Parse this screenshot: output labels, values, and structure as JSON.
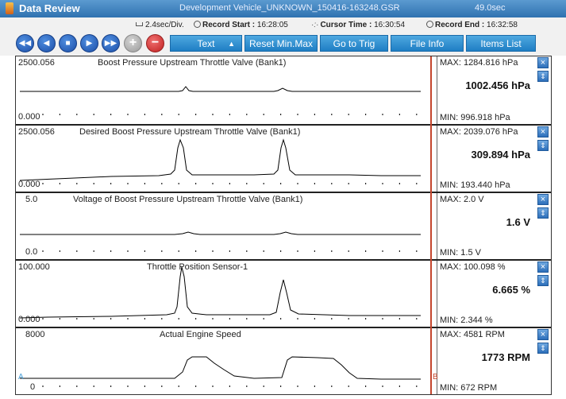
{
  "window": {
    "title": "Data Review",
    "file_name": "Development Vehicle_UNKNOWN_150416-163248.GSR",
    "duration": "49.0sec"
  },
  "info": {
    "time_div": "2.4sec/Div.",
    "record_start_label": "Record Start :",
    "record_start_value": "16:28:05",
    "cursor_time_label": "Cursor Time :",
    "cursor_time_value": "16:30:54",
    "record_end_label": "Record End :",
    "record_end_value": "16:32:58"
  },
  "toolbar": {
    "first_icon": "skip-back-icon",
    "prev_icon": "play-reverse-icon",
    "stop_icon": "stop-icon",
    "play_icon": "play-icon",
    "next_icon": "skip-forward-icon",
    "zoom_in_symbol": "+",
    "zoom_out_symbol": "−",
    "text_select_label": "Text",
    "reset_label": "Reset Min.Max",
    "goto_trig_label": "Go to Trig",
    "file_info_label": "File Info",
    "items_list_label": "Items List"
  },
  "cursor": {
    "label_a": "A",
    "label_b": "B"
  },
  "channels": [
    {
      "name": "Boost Pressure Upstream Throttle Valve (Bank1)",
      "scale_max": "2500.056",
      "scale_min": "0.000",
      "max_text": "MAX: 1284.816 hPa",
      "min_text": "MIN: 996.918 hPa",
      "current_value": "1002.456 hPa"
    },
    {
      "name": "Desired Boost Pressure Upstream Throttle Valve (Bank1)",
      "scale_max": "2500.056",
      "scale_min": "0.000",
      "max_text": "MAX: 2039.076 hPa",
      "min_text": "MIN: 193.440 hPa",
      "current_value": "309.894 hPa"
    },
    {
      "name": "Voltage of Boost Pressure Upstream Throttle Valve (Bank1)",
      "scale_max": "5.0",
      "scale_min": "0.0",
      "max_text": "MAX:   2.0 V",
      "min_text": "MIN:   1.5 V",
      "current_value": "1.6 V"
    },
    {
      "name": "Throttle Position Sensor-1",
      "scale_max": "100.000",
      "scale_min": "0.000",
      "max_text": "MAX: 100.098 %",
      "min_text": "MIN: 2.344 %",
      "current_value": "6.665 %"
    },
    {
      "name": "Actual Engine Speed",
      "scale_max": "8000",
      "scale_min": "0",
      "max_text": "MAX:  4581 RPM",
      "min_text": "MIN:   672 RPM",
      "current_value": "1773 RPM"
    }
  ],
  "side_controls": {
    "close_symbol": "×",
    "move_symbol": "⇕"
  },
  "colors": {
    "title_bar": "#2f72b0",
    "button": "#1f7ec4",
    "cursor_line": "#c4462e",
    "trace": "#000000"
  }
}
